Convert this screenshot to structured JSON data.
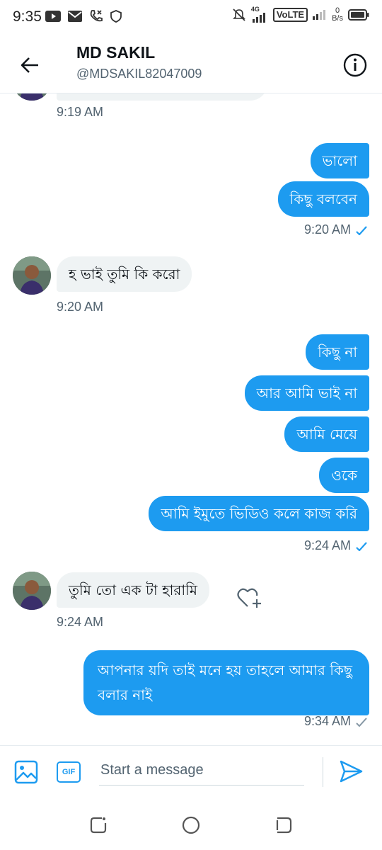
{
  "status_bar": {
    "time": "9:35",
    "network": "4G",
    "volte": "VoLTE",
    "speed_value": "0",
    "speed_unit": "B/s"
  },
  "header": {
    "name": "MD SAKIL",
    "handle": "@MDSAKIL82047009"
  },
  "messages": [
    {
      "id": "t0",
      "kind": "timestamp",
      "dir": "in",
      "text": "9:19 AM"
    },
    {
      "id": "m1",
      "kind": "bubble",
      "dir": "out",
      "text": "ভালো"
    },
    {
      "id": "m2",
      "kind": "bubble",
      "dir": "out",
      "text": "কিছু বলবেন"
    },
    {
      "id": "t1",
      "kind": "timestamp",
      "dir": "out",
      "text": "9:20 AM",
      "status": "seen"
    },
    {
      "id": "m3",
      "kind": "bubble",
      "dir": "in",
      "text": "হ ভাই তুমি কি করো"
    },
    {
      "id": "t2",
      "kind": "timestamp",
      "dir": "in",
      "text": "9:20 AM"
    },
    {
      "id": "m4",
      "kind": "bubble",
      "dir": "out",
      "text": "কিছু না"
    },
    {
      "id": "m5",
      "kind": "bubble",
      "dir": "out",
      "text": "আর আমি ভাই না"
    },
    {
      "id": "m6",
      "kind": "bubble",
      "dir": "out",
      "text": "আমি মেয়ে"
    },
    {
      "id": "m7",
      "kind": "bubble",
      "dir": "out",
      "text": "ওকে"
    },
    {
      "id": "m8",
      "kind": "bubble",
      "dir": "out",
      "text": "আমি ইমুতে ভিডিও কলে কাজ করি"
    },
    {
      "id": "t3",
      "kind": "timestamp",
      "dir": "out",
      "text": "9:24 AM",
      "status": "seen"
    },
    {
      "id": "m9",
      "kind": "bubble",
      "dir": "in",
      "text": "তুমি তো এক টা  হারামি"
    },
    {
      "id": "t4",
      "kind": "timestamp",
      "dir": "in",
      "text": "9:24 AM"
    },
    {
      "id": "m10",
      "kind": "bubble",
      "dir": "out",
      "text": "আপনার য়দি তাই মনে হয় তাহলে আমার কিছু বলার নাই"
    },
    {
      "id": "t5",
      "kind": "timestamp",
      "dir": "out",
      "text": "9:34 AM",
      "status": "sent"
    }
  ],
  "composer": {
    "placeholder": "Start a message",
    "gif_label": "GIF"
  },
  "colors": {
    "accent": "#1d9bf0",
    "incoming_bubble": "#eff3f4",
    "muted_text": "#536471"
  },
  "icons": {
    "back": "arrow-left-icon",
    "info": "info-icon",
    "media": "image-icon",
    "send": "send-icon",
    "react": "heart-plus-icon"
  }
}
